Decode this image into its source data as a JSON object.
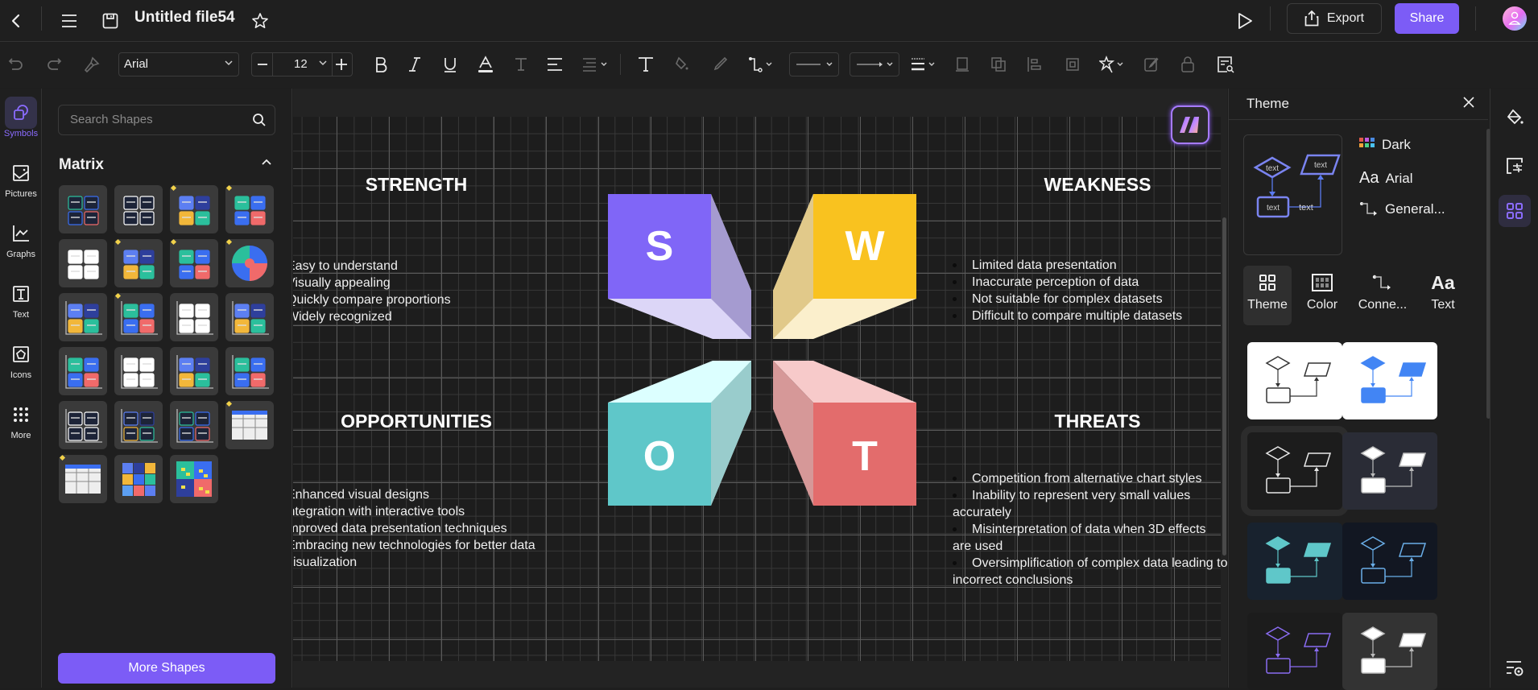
{
  "header": {
    "file_title": "Untitled file54",
    "export_label": "Export",
    "share_label": "Share",
    "icons": [
      "back-icon",
      "menu-icon",
      "save-icon",
      "star-icon",
      "play-icon",
      "export-icon",
      "avatar"
    ]
  },
  "toolbar": {
    "font_family": "Arial",
    "font_size": "12",
    "icons": [
      "undo-icon",
      "redo-icon",
      "format-painter-icon",
      "bold-icon",
      "italic-icon",
      "underline-icon",
      "font-color-icon",
      "text-style-icon",
      "align-icon",
      "line-spacing-icon",
      "text-tool-icon",
      "fill-icon",
      "pen-icon",
      "connector-icon",
      "line-style-select",
      "arrow-style-select",
      "line-weight-icon",
      "bring-front-icon",
      "send-back-icon",
      "align-objects-icon",
      "group-icon",
      "effects-icon",
      "edit-icon",
      "lock-icon",
      "find-icon"
    ]
  },
  "left_rail": {
    "items": [
      {
        "label": "Symbols",
        "icon": "symbols-icon",
        "active": true
      },
      {
        "label": "Pictures",
        "icon": "pictures-icon",
        "active": false
      },
      {
        "label": "Graphs",
        "icon": "graphs-icon",
        "active": false
      },
      {
        "label": "Text",
        "icon": "text-icon",
        "active": false
      },
      {
        "label": "Icons",
        "icon": "icons-icon",
        "active": false
      },
      {
        "label": "More",
        "icon": "more-icon",
        "active": false
      }
    ]
  },
  "shapes_panel": {
    "search_placeholder": "Search Shapes",
    "section_title": "Matrix",
    "tile_count": 23,
    "more_shapes_label": "More Shapes"
  },
  "canvas": {
    "swot": {
      "strength": {
        "letter": "S",
        "title": "STRENGTH",
        "color": "#8066f7",
        "items": [
          "Easy to understand",
          "Visually appealing",
          "Quickly compare proportions",
          "Widely recognized"
        ]
      },
      "weakness": {
        "letter": "W",
        "title": "WEAKNESS",
        "color": "#f9c21f",
        "items": [
          "Limited data presentation",
          "Inaccurate perception of data",
          "Not suitable for complex datasets",
          "Difficult to compare multiple datasets"
        ]
      },
      "opportunities": {
        "letter": "O",
        "title": "OPPORTUNITIES",
        "color": "#5fc7c9",
        "items": [
          "Enhanced visual designs",
          "Integration with interactive tools",
          "Improved data presentation techniques",
          "Embracing new technologies for better data visualization"
        ]
      },
      "threats": {
        "letter": "T",
        "title": "THREATS",
        "color": "#e36c6c",
        "items": [
          "Competition from alternative chart styles",
          "Inability to represent very small values accurately",
          "Misinterpretation of data when 3D effects are used",
          "Oversimplification of complex data leading to incorrect conclusions"
        ]
      }
    }
  },
  "theme_panel": {
    "title": "Theme",
    "preview_labels": {
      "diamond": "text",
      "parallelogram": "text",
      "rect": "text",
      "edge": "text"
    },
    "current": {
      "color_scheme": "Dark",
      "font": "Arial",
      "connector": "General..."
    },
    "tabs": [
      {
        "label": "Theme",
        "active": true
      },
      {
        "label": "Color",
        "active": false
      },
      {
        "label": "Conne...",
        "active": false
      },
      {
        "label": "Text",
        "active": false
      }
    ],
    "theme_cards": [
      {
        "name": "light-outline",
        "bg": "#ffffff",
        "stroke": "#333333",
        "fill": "none"
      },
      {
        "name": "light-blue",
        "bg": "#ffffff",
        "stroke": "#4285f4",
        "fill": "#4285f4"
      },
      {
        "name": "dark-outline",
        "bg": "#1c1c1c",
        "stroke": "#e8e8e8",
        "fill": "none",
        "selected": true
      },
      {
        "name": "slate-white",
        "bg": "#2a2c36",
        "stroke": "#bbbbbb",
        "fill": "#ffffff"
      },
      {
        "name": "navy-teal",
        "bg": "#18222e",
        "stroke": "#5fc7c9",
        "fill": "#5fc7c9"
      },
      {
        "name": "midnight-blue",
        "bg": "#121722",
        "stroke": "#6aaee8",
        "fill": "none"
      },
      {
        "name": "dark-purple",
        "bg": "#1c1c1c",
        "stroke": "#8a6cf2",
        "fill": "none"
      },
      {
        "name": "gray-white",
        "bg": "#333333",
        "stroke": "#bbbbbb",
        "fill": "#ffffff"
      }
    ]
  },
  "right_rail": {
    "icons": [
      "style-fill-icon",
      "page-setup-icon",
      "theme-icon",
      "settings-icon"
    ]
  }
}
